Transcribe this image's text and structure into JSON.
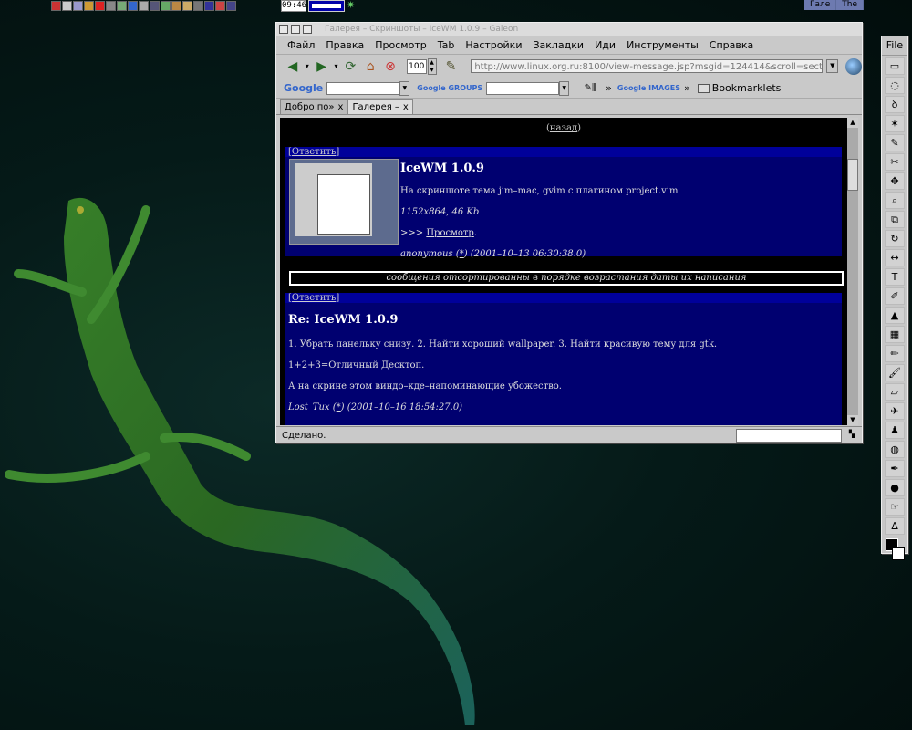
{
  "panel": {
    "clock": "09:46",
    "tasks": [
      "Галe",
      "The"
    ]
  },
  "browser": {
    "title": "Галерея – Скриншоты – IceWM 1.0.9 – Galeon",
    "menu": [
      "Файл",
      "Правка",
      "Просмотр",
      "Tab",
      "Настройки",
      "Закладки",
      "Иди",
      "Инструменты",
      "Справка"
    ],
    "zoom": "100",
    "url": "http://www.linux.org.ru:8100/view-message.jsp?msgid=124414&scroll=section&back=",
    "search": {
      "google_label": "Google",
      "google_groups_label": "Google GROUPS",
      "google_images_label": "Google IMAGES",
      "bookmarklets_label": "Bookmarklets"
    },
    "tabs": [
      {
        "label": "Добро по»",
        "close": "x",
        "active": false
      },
      {
        "label": "Галерея –",
        "close": "x",
        "active": true
      }
    ],
    "status": "Сделано.",
    "page": {
      "back_link": "назад",
      "reply_label": "Ответить",
      "post1": {
        "title": "IceWM 1.0.9",
        "description": "На скриншоте тема jim–mac, gvim с плагином project.vim",
        "size": "1152x864, 46 Kb",
        "view_prefix": ">>> ",
        "view_link": "Просмотр",
        "view_suffix": ".",
        "author": "anonymous",
        "author_link": "*",
        "date": "(2001–10–13 06:30:38.0)"
      },
      "notice": "сообщения отсортированны в порядке возрастания даты их написания",
      "post2": {
        "title": "Re: IceWM 1.0.9",
        "line1": "1. Убрать панельку снизу. 2. Найти хороший wallpaper. 3. Найти красивую тему для gtk.",
        "line2": "1+2+3=Отличный Десктоп.",
        "line3": "А на скрине этом виндо–кде–напоминающие убожество.",
        "author": "Lost_Tux",
        "author_link": "*",
        "date": "(2001–10–16 18:54:27.0)"
      }
    }
  },
  "toolbox": {
    "menu": "File",
    "tools": [
      "rect-select-icon",
      "ellipse-select-icon",
      "lasso-icon",
      "magic-wand-icon",
      "bezier-select-icon",
      "scissors-icon",
      "move-icon",
      "zoom-icon",
      "crop-icon",
      "transform-icon",
      "flip-icon",
      "text-icon",
      "color-picker-icon",
      "bucket-fill-icon",
      "gradient-icon",
      "pencil-icon",
      "paintbrush-icon",
      "eraser-icon",
      "airbrush-icon",
      "clone-icon",
      "blur-icon",
      "ink-icon",
      "dodge-burn-icon",
      "smudge-icon",
      "measure-icon"
    ],
    "tool_glyphs": [
      "▭",
      "◌",
      "ꝺ",
      "✶",
      "✎",
      "✂",
      "✥",
      "⌕",
      "⧉",
      "↻",
      "↔",
      "T",
      "✐",
      "▲",
      "▦",
      "✏",
      "🖌",
      "▱",
      "✈",
      "♟",
      "◍",
      "✒",
      "●",
      "☞",
      "∆"
    ]
  }
}
